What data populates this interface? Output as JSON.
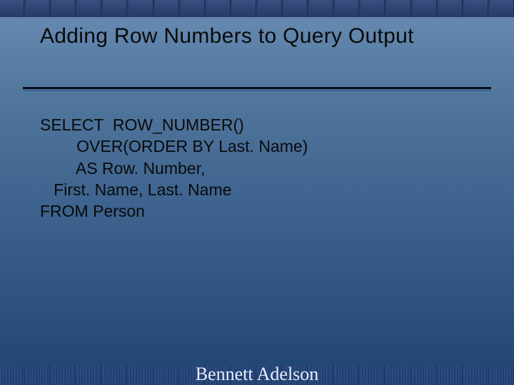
{
  "title": "Adding Row Numbers to Query Output",
  "code": {
    "line1": "SELECT  ROW_NUMBER()",
    "line2": "        OVER(ORDER BY Last. Name)",
    "line3": "        AS Row. Number,",
    "line4": "   First. Name, Last. Name",
    "line5": "FROM Person"
  },
  "footer": "Bennett Adelson"
}
